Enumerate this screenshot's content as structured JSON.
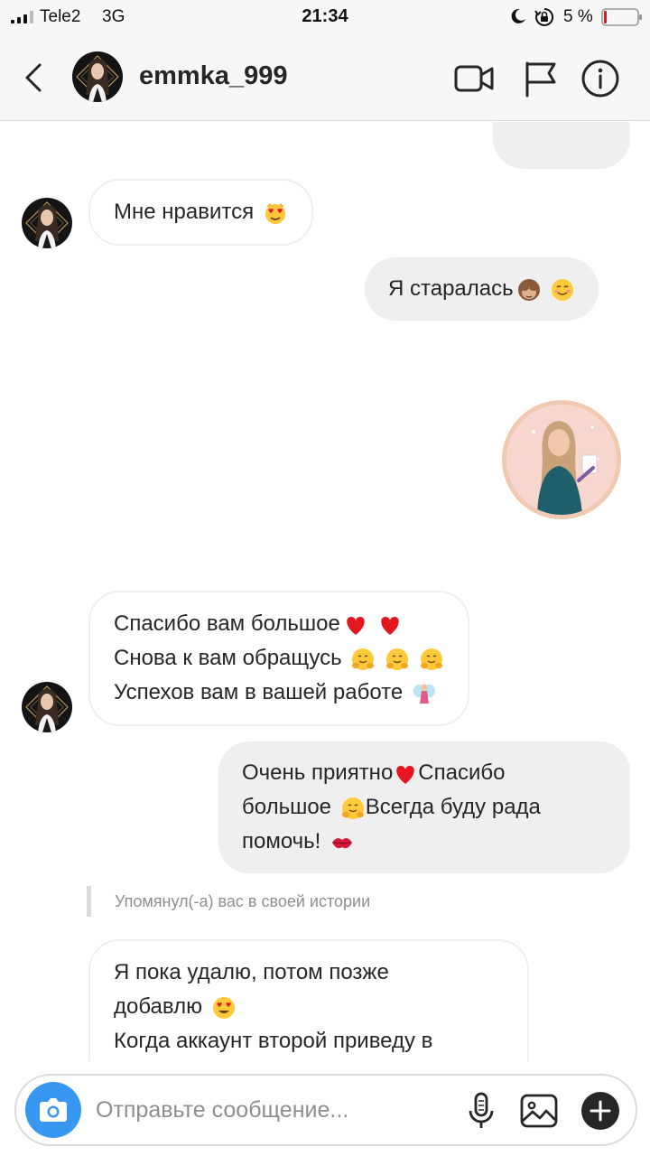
{
  "status_bar": {
    "carrier": "Tele2",
    "network": "3G",
    "time": "21:34",
    "battery": "5 %",
    "icons": [
      "signal-icon",
      "moon-icon",
      "orientation-lock-icon",
      "battery-icon"
    ]
  },
  "header": {
    "username": "emmka_999",
    "icons": [
      "back-icon",
      "avatar",
      "video-camera-icon",
      "flag-icon",
      "info-icon"
    ]
  },
  "messages": [
    {
      "from": "them",
      "text": "Мне нравится",
      "emoji": [
        "heart-eyes-cat-emoji"
      ]
    },
    {
      "from": "me",
      "text": "Я старалась",
      "emoji": [
        "see-no-evil-monkey-emoji",
        "smiling-face-emoji"
      ]
    },
    {
      "from": "me",
      "type": "story-share",
      "content": "story-avatar-image"
    },
    {
      "from": "them",
      "lines": [
        "Спасибо вам большое",
        "Снова к вам обращусь",
        "Успехов вам в вашей работе"
      ],
      "emoji": [
        "red-heart-emoji",
        "red-heart-emoji",
        "hugging-face-emoji",
        "hugging-face-emoji",
        "hugging-face-emoji",
        "fairy-emoji"
      ]
    },
    {
      "from": "me",
      "lines": [
        "Очень приятно",
        "Спасибо",
        "большое",
        "Всегда буду рада",
        "помочь!"
      ],
      "emoji": [
        "red-heart-emoji",
        "hugging-face-emoji",
        "kiss-mark-emoji"
      ]
    },
    {
      "type": "system",
      "text": "Упомянул(-а) вас в своей истории"
    },
    {
      "from": "them",
      "lines": [
        "Я пока удалю, потом позже",
        "добавлю",
        "Когда аккаунт второй приведу в"
      ],
      "emoji": [
        "heart-eyes-emoji"
      ]
    }
  ],
  "composer": {
    "placeholder": "Отправьте сообщение...",
    "icons": [
      "camera-icon",
      "microphone-icon",
      "gallery-icon",
      "plus-icon"
    ]
  },
  "colors": {
    "accent": "#3897f0",
    "bar_background": "#f7f7f7",
    "outgoing_bubble": "#efefef",
    "border": "#dbdbdb",
    "muted_text": "#8e8e8e"
  }
}
